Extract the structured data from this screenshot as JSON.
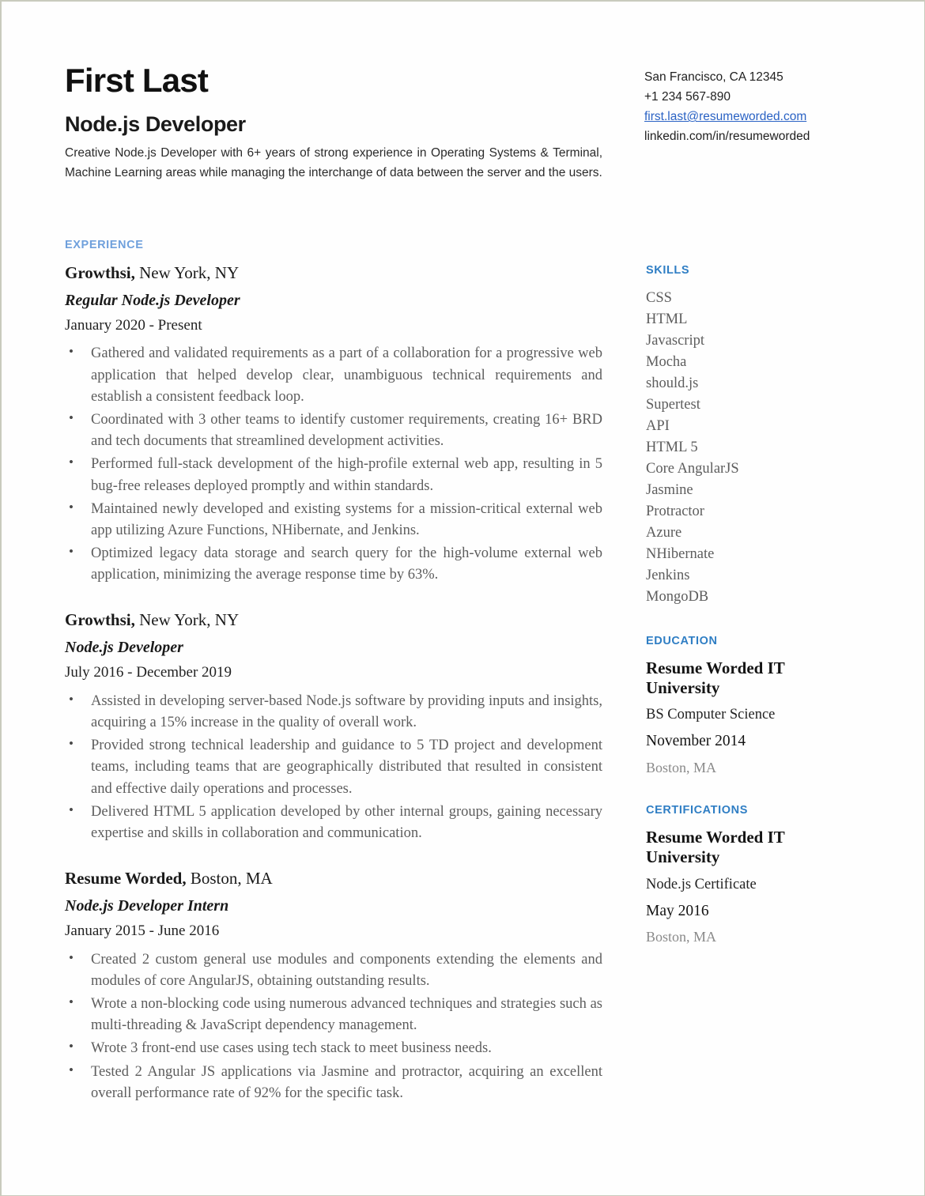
{
  "colors": {
    "section_heading_main": "#6fa0dc",
    "section_heading_side": "#2f7ec4",
    "link": "#2a62c4",
    "body_text": "#5d5d5d",
    "page_border": "#c9cbbd"
  },
  "header": {
    "name": "First Last",
    "job_title": "Node.js Developer",
    "summary": "Creative Node.js Developer with 6+ years of strong experience in Operating Systems & Terminal, Machine Learning areas while managing the interchange of data between the server and the users."
  },
  "contact": {
    "address": "San Francisco, CA 12345",
    "phone": "+1 234 567-890",
    "email": "first.last@resumeworded.com",
    "linkedin": "linkedin.com/in/resumeworded"
  },
  "experience": {
    "heading": "EXPERIENCE",
    "jobs": [
      {
        "company": "Growthsi,",
        "location": "New York, NY",
        "role": "Regular Node.js Developer",
        "dates": "January 2020 - Present",
        "bullets": [
          "Gathered and validated requirements as a part of a collaboration for a progressive web application that helped develop clear, unambiguous technical requirements and establish a consistent feedback loop.",
          "Coordinated with 3 other teams to identify customer requirements, creating 16+ BRD and tech documents that streamlined development activities.",
          "Performed full-stack development of the high-profile external web app, resulting in 5 bug-free releases deployed promptly and within standards.",
          "Maintained newly developed and existing systems for a mission-critical external web app utilizing Azure Functions, NHibernate, and Jenkins.",
          "Optimized legacy data storage and search query for the high-volume external web application, minimizing the average response time by 63%."
        ]
      },
      {
        "company": "Growthsi,",
        "location": "New York, NY",
        "role": "Node.js Developer",
        "dates": "July 2016 - December 2019",
        "bullets": [
          "Assisted in developing server-based Node.js software by providing inputs and insights, acquiring a 15% increase in the quality of overall work.",
          "Provided strong technical leadership and guidance to 5 TD project and development teams, including teams that are geographically distributed that resulted in consistent and effective daily operations and processes.",
          "Delivered HTML 5 application developed by other internal groups, gaining necessary expertise and skills in collaboration and communication."
        ]
      },
      {
        "company": "Resume Worded,",
        "location": "Boston, MA",
        "role": "Node.js Developer Intern",
        "dates": "January 2015 - June 2016",
        "bullets": [
          "Created 2 custom general use modules and components extending the elements and modules of core AngularJS, obtaining outstanding results.",
          "Wrote a non-blocking code using numerous advanced techniques and strategies such as multi-threading & JavaScript dependency management.",
          "Wrote 3 front-end use cases using tech stack to meet business needs.",
          "Tested 2 Angular JS applications via Jasmine and protractor, acquiring an excellent overall performance rate of 92% for the specific task."
        ]
      }
    ]
  },
  "skills": {
    "heading": "SKILLS",
    "items": [
      "CSS",
      "HTML",
      "Javascript",
      "Mocha",
      "should.js",
      "Supertest",
      "API",
      "HTML 5",
      "Core AngularJS",
      "Jasmine",
      "Protractor",
      "Azure",
      "NHibernate",
      "Jenkins",
      "MongoDB"
    ]
  },
  "education": {
    "heading": "EDUCATION",
    "organization": "Resume Worded IT University",
    "degree": "BS Computer Science",
    "date": "November 2014",
    "location": "Boston, MA"
  },
  "certifications": {
    "heading": "CERTIFICATIONS",
    "organization": "Resume Worded IT University",
    "name": "Node.js Certificate",
    "date": "May 2016",
    "location": "Boston, MA"
  }
}
